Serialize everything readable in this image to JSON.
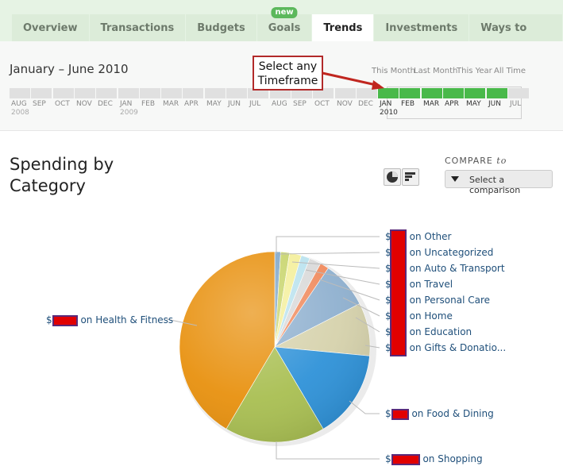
{
  "tabs": [
    {
      "label": "Overview"
    },
    {
      "label": "Transactions"
    },
    {
      "label": "Budgets"
    },
    {
      "label": "Goals",
      "badge": "new"
    },
    {
      "label": "Trends",
      "active": true
    },
    {
      "label": "Investments"
    },
    {
      "label": "Ways to Save"
    }
  ],
  "timeframe": {
    "date_range": "January – June 2010",
    "quick_links": [
      "This Month",
      "Last Month",
      "This Year",
      "All Time"
    ],
    "months": [
      "AUG",
      "SEP",
      "OCT",
      "NOV",
      "DEC",
      "JAN",
      "FEB",
      "MAR",
      "APR",
      "MAY",
      "JUN",
      "JUL",
      "AUG",
      "SEP",
      "OCT",
      "NOV",
      "DEC",
      "JAN",
      "FEB",
      "MAR",
      "APR",
      "MAY",
      "JUN",
      "JUL"
    ],
    "year_labels": [
      "2008",
      "2009",
      "2010"
    ],
    "selected_months": [
      "JAN",
      "FEB",
      "MAR",
      "APR",
      "MAY",
      "JUN"
    ]
  },
  "callout": {
    "line1": "Select any",
    "line2": "Timeframe"
  },
  "title": {
    "line1": "Spending by",
    "line2": "Category"
  },
  "compare": {
    "label": "COMPARE",
    "label_suffix": "to",
    "button": "Select a comparison"
  },
  "legend": {
    "health": {
      "prefix": "$",
      "text": "on Health & Fitness"
    },
    "other": {
      "prefix": "$",
      "text": "on Other"
    },
    "uncategorized": {
      "prefix": "$",
      "text": "on Uncategorized"
    },
    "auto": {
      "prefix": "$",
      "text": "on Auto & Transport"
    },
    "travel": {
      "prefix": "$",
      "text": "on Travel"
    },
    "personal": {
      "prefix": "$",
      "text": "on Personal Care"
    },
    "home": {
      "prefix": "$",
      "text": "on Home"
    },
    "education": {
      "prefix": "$",
      "text": "on Education"
    },
    "gifts": {
      "prefix": "$",
      "text": "on Gifts & Donatio..."
    },
    "food": {
      "prefix": "$",
      "text": "on Food & Dining"
    },
    "shopping": {
      "prefix": "$",
      "text": "on Shopping"
    }
  },
  "chart_data": {
    "type": "pie",
    "categories": [
      "Other",
      "Uncategorized",
      "Auto & Transport",
      "Travel",
      "Personal Care",
      "Home",
      "Education",
      "Gifts & Donations",
      "Food & Dining",
      "Shopping",
      "Health & Fitness"
    ],
    "values": [
      1,
      1.5,
      2,
      1.5,
      2,
      1.5,
      8,
      9,
      15,
      17,
      41.5
    ],
    "colors": [
      "#7fa7c9",
      "#c7d46a",
      "#f4ef9a",
      "#b9e2ee",
      "#d9d9d9",
      "#f08a5d",
      "#8fb0cf",
      "#d6d2ac",
      "#2f92d8",
      "#a9bf52",
      "#e8910f"
    ]
  },
  "icons": {
    "pie_view": "pie-chart-icon",
    "bar_view": "bar-chart-icon",
    "compare": "triangle-down-icon"
  }
}
